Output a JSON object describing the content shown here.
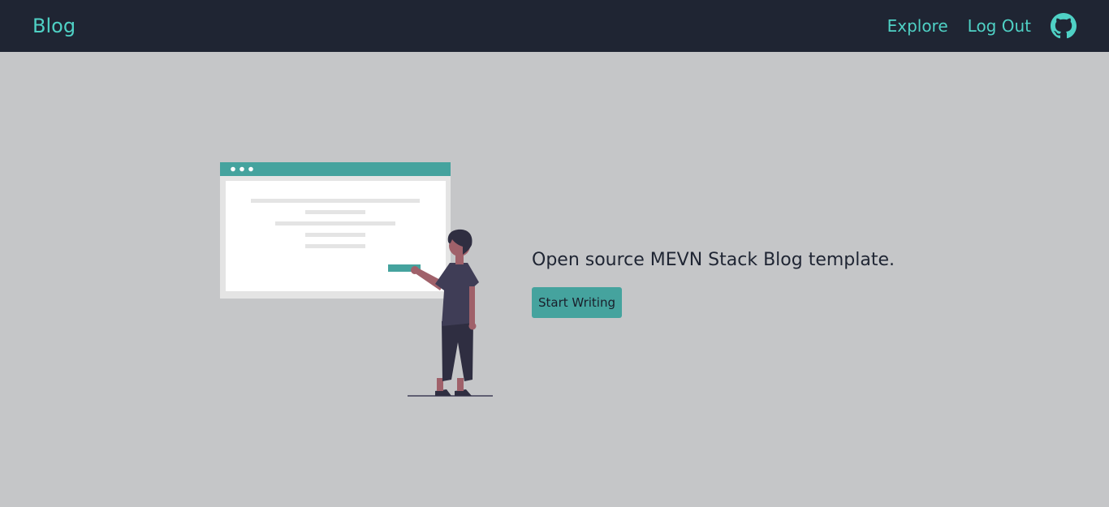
{
  "navbar": {
    "brand": "Blog",
    "links": [
      {
        "label": "Explore"
      },
      {
        "label": "Log Out"
      }
    ],
    "github_icon": "github-icon"
  },
  "hero": {
    "illustration": "person-presenting-browser-window",
    "tagline": "Open source MEVN Stack Blog template.",
    "cta_label": "Start Writing"
  },
  "colors": {
    "navbar_bg": "#1f2533",
    "accent": "#4fd1c5",
    "page_bg": "#c5c6c8",
    "button_bg": "#45a39e"
  }
}
